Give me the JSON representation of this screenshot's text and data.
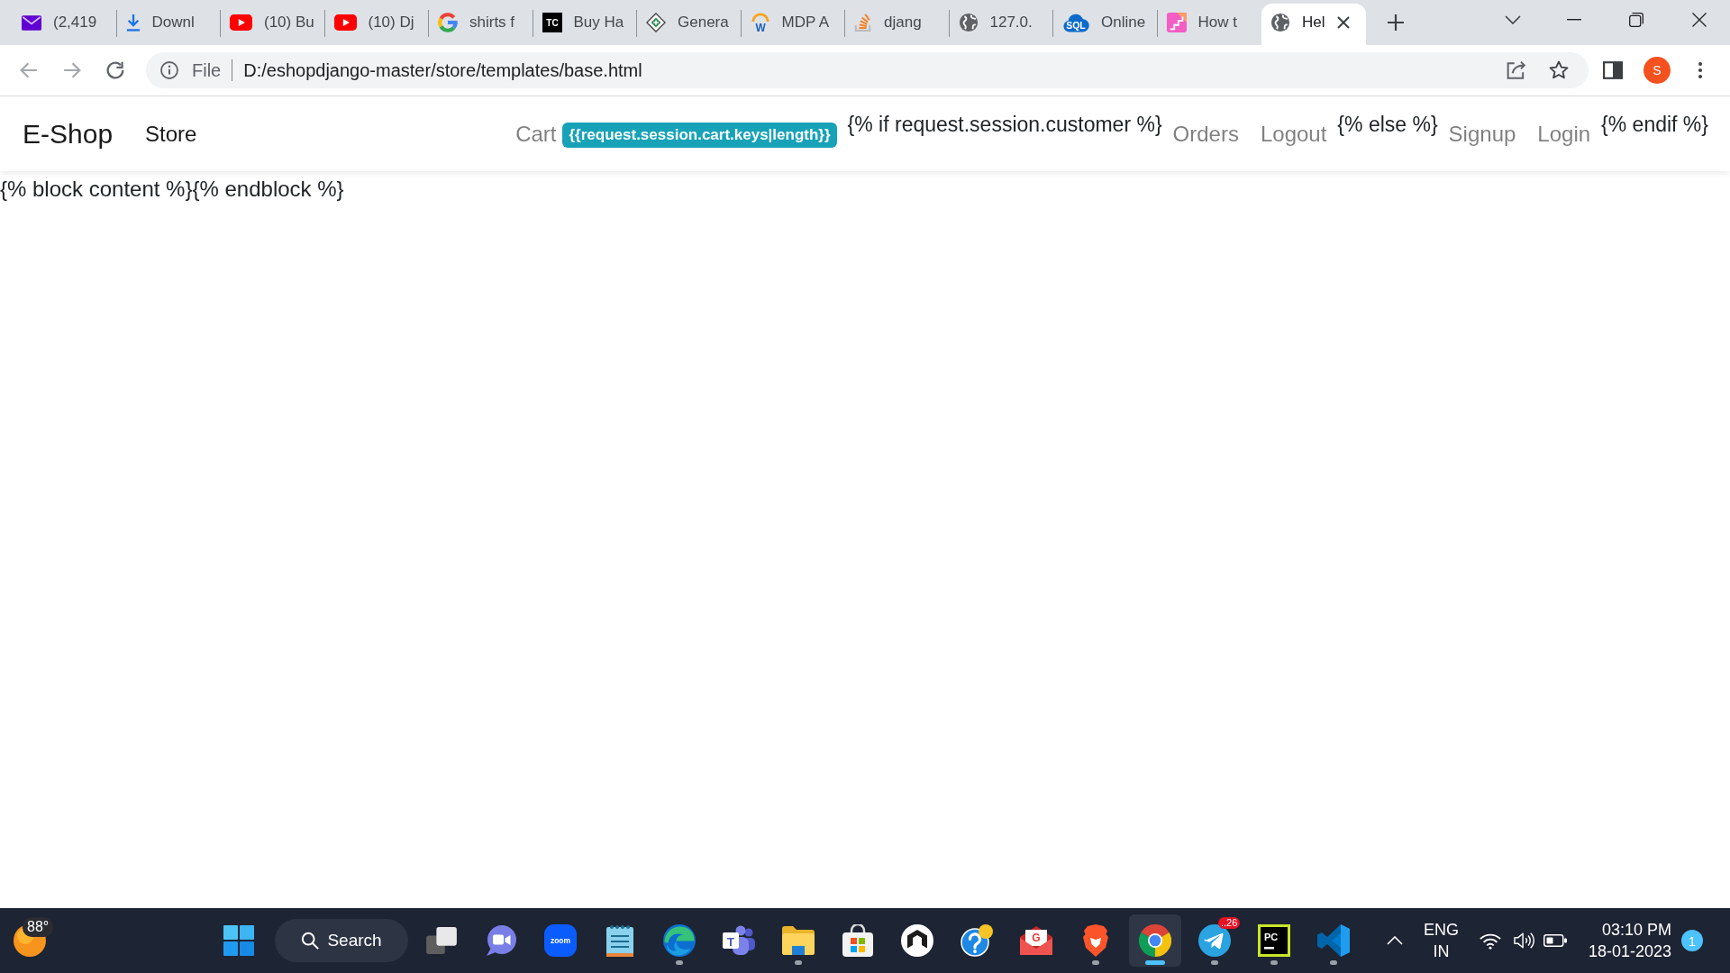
{
  "browser": {
    "tabs": [
      {
        "title": "(2,419",
        "selected": false
      },
      {
        "title": "Downl",
        "selected": false
      },
      {
        "title": "(10) Bu",
        "selected": false
      },
      {
        "title": "(10) Dj",
        "selected": false
      },
      {
        "title": "shirts f",
        "selected": false
      },
      {
        "title": "Buy Ha",
        "icon_text": "TC",
        "selected": false
      },
      {
        "title": "Genera",
        "selected": false
      },
      {
        "title": "MDP A",
        "icon_text": "W",
        "selected": false
      },
      {
        "title": "djang",
        "selected": false
      },
      {
        "title": "127.0.",
        "selected": false
      },
      {
        "title": "Online",
        "icon_text": "SQL",
        "selected": false
      },
      {
        "title": "How t",
        "selected": false
      },
      {
        "title": "Hel",
        "selected": true
      }
    ],
    "navigation": [
      {
        "disabled": true
      },
      {
        "disabled": true
      },
      {
        "disabled": false
      }
    ],
    "address_bar": {
      "security_label": "File",
      "url": "D:/eshopdjango-master/store/templates/base.html"
    },
    "profile": {
      "initial": "S"
    }
  },
  "page": {
    "navbar": {
      "brand": "E-Shop",
      "left": [
        {
          "kind": "link",
          "label": "Store",
          "selected": true
        }
      ],
      "right": [
        {
          "kind": "link",
          "label": "Cart",
          "selected": false
        },
        {
          "kind": "badge",
          "label": "{{request.session.cart.keys|length}}"
        },
        {
          "kind": "template",
          "label": "{% if request.session.customer %}"
        },
        {
          "kind": "link",
          "label": "Orders",
          "selected": false
        },
        {
          "kind": "link",
          "label": "Logout",
          "selected": false
        },
        {
          "kind": "template",
          "label": "{% else %}"
        },
        {
          "kind": "link",
          "label": "Signup",
          "selected": false
        },
        {
          "kind": "link",
          "label": "Login",
          "selected": false
        },
        {
          "kind": "template",
          "label": "{% endif %}"
        }
      ]
    },
    "content": "{% block content %}{% endblock %}"
  },
  "taskbar": {
    "weather": {
      "temperature": "88°"
    },
    "search": {
      "label": "Search"
    },
    "apps": [
      {
        "running": false,
        "selected": false
      },
      {
        "running": false,
        "selected": false
      },
      {
        "icon_text": "zoom",
        "running": false,
        "selected": false
      },
      {
        "running": false,
        "selected": false
      },
      {
        "running": true,
        "selected": false
      },
      {
        "icon_text": "T",
        "running": false,
        "selected": false
      },
      {
        "running": true,
        "selected": false
      },
      {
        "running": false,
        "selected": false
      },
      {
        "running": false,
        "selected": false
      },
      {
        "running": false,
        "selected": false
      },
      {
        "icon_text": "G",
        "running": false,
        "selected": false
      },
      {
        "running": true,
        "selected": false
      },
      {
        "running": true,
        "selected": true
      },
      {
        "badge": "..26",
        "running": true,
        "selected": false
      },
      {
        "icon_text": "PC",
        "running": true,
        "selected": false
      },
      {
        "running": true,
        "selected": false
      }
    ],
    "tray": {
      "language": "ENG",
      "region": "IN",
      "time": "03:10 PM",
      "date": "18-01-2023",
      "notification_count": "1"
    }
  }
}
